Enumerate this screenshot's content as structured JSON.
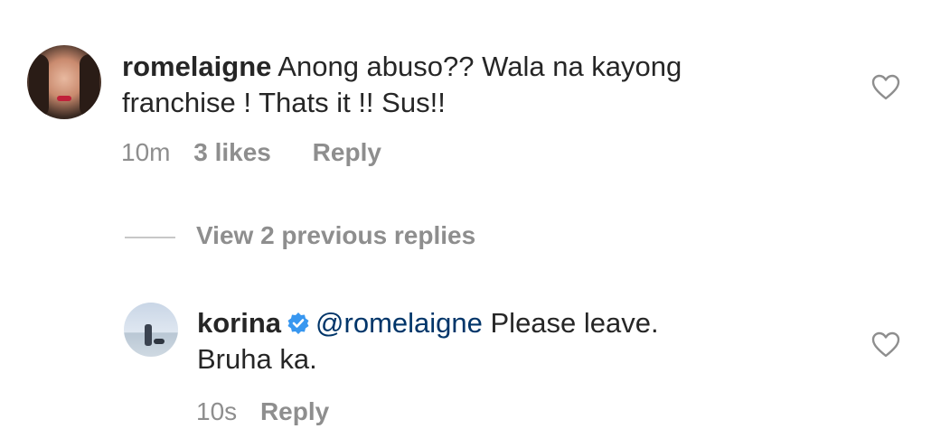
{
  "comment": {
    "username": "romelaigne",
    "text_line1": "Anong abuso?? Wala na kayong",
    "text_line2": "franchise ! Thats it !! Sus!!",
    "time": "10m",
    "likes": "3 likes",
    "reply_label": "Reply"
  },
  "view_replies": "View 2 previous replies",
  "reply": {
    "username": "korina",
    "mention": "@romelaigne",
    "text_line1": "Please leave.",
    "text_line2": "Bruha ka.",
    "time": "10s",
    "reply_label": "Reply"
  },
  "colors": {
    "text": "#262626",
    "secondary": "#8e8e8e",
    "mention": "#003569",
    "verified": "#3897f0"
  },
  "icons": [
    "heart-icon",
    "verified-badge-icon"
  ]
}
